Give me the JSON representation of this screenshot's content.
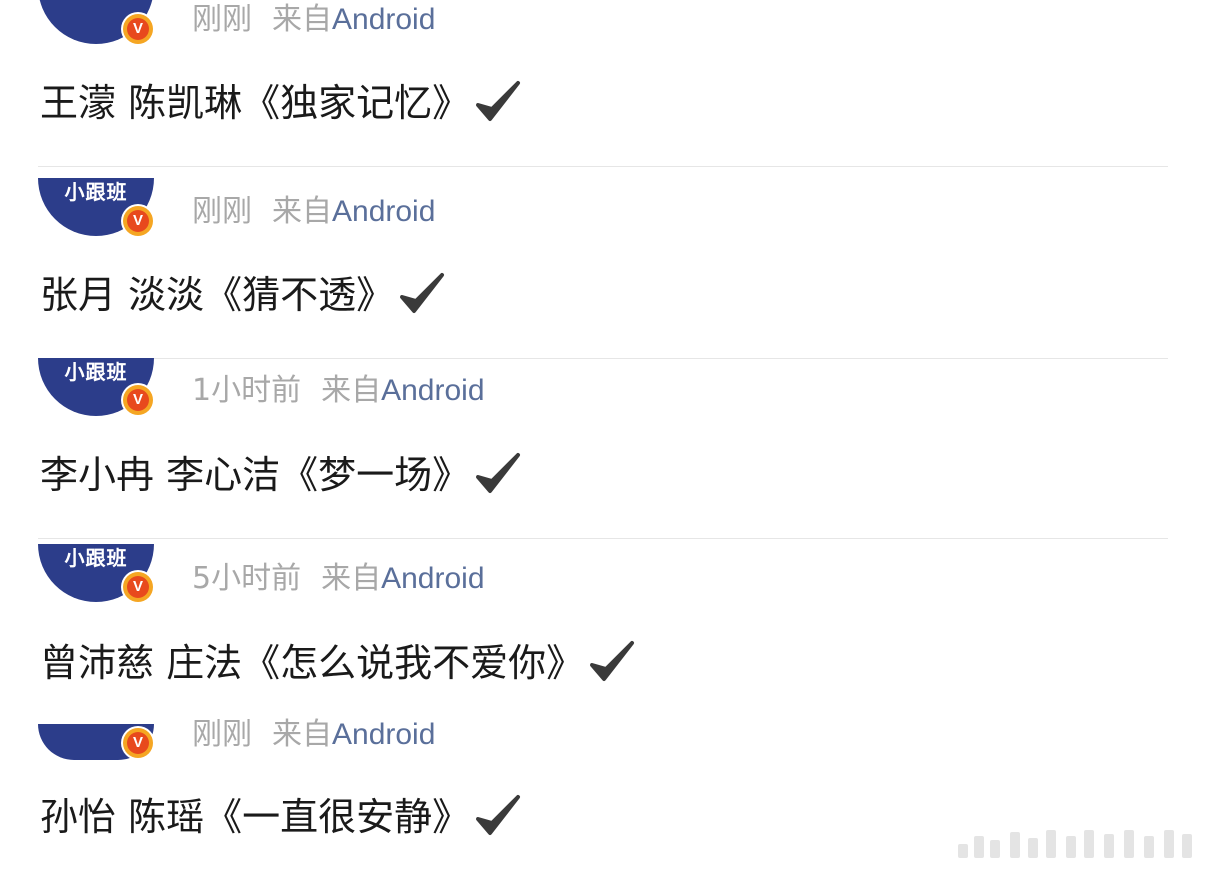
{
  "posts": [
    {
      "avatar_text": "",
      "badge": "V",
      "time": "刚刚",
      "source_prefix": "来自",
      "source_app": "Android",
      "content": "王濛 陈凯琳《独家记忆》",
      "check_icon": "checkmark-icon"
    },
    {
      "avatar_text": "小跟班",
      "badge": "V",
      "time": "刚刚",
      "source_prefix": "来自",
      "source_app": "Android",
      "content": "张月 淡淡《猜不透》",
      "check_icon": "checkmark-icon"
    },
    {
      "avatar_text": "小跟班",
      "badge": "V",
      "time": "1小时前",
      "source_prefix": "来自",
      "source_app": "Android",
      "content": "李小冉 李心洁《梦一场》",
      "check_icon": "checkmark-icon"
    },
    {
      "avatar_text": "小跟班",
      "badge": "V",
      "time": "5小时前",
      "source_prefix": "来自",
      "source_app": "Android",
      "content": "曾沛慈 庄法《怎么说我不爱你》",
      "check_icon": "checkmark-icon"
    },
    {
      "avatar_text": "",
      "badge": "V",
      "time": "刚刚",
      "source_prefix": "来自",
      "source_app": "Android",
      "content": "孙怡 陈瑶《一直很安静》",
      "check_icon": "checkmark-icon"
    }
  ],
  "colors": {
    "avatar": "#2c3d8a",
    "badge_outer": "#f5a623",
    "badge_inner": "#e8491d",
    "meta_text": "#a8a8a8",
    "source_link": "#5a6f9a",
    "content_text": "#1a1a1a",
    "checkmark": "#3a3a3a"
  }
}
